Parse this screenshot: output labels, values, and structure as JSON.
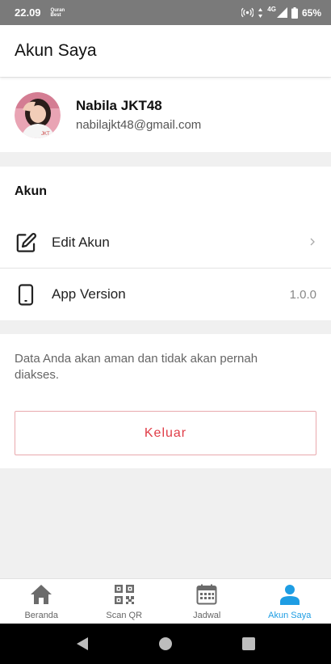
{
  "status_bar": {
    "time": "22.09",
    "app_badge_line1": "Quran",
    "app_badge_line2": "Best",
    "network": "4G",
    "battery": "65%"
  },
  "header": {
    "title": "Akun Saya"
  },
  "profile": {
    "name": "Nabila JKT48",
    "email": "nabilajkt48@gmail.com"
  },
  "account_section": {
    "title": "Akun",
    "items": [
      {
        "label": "Edit Akun",
        "icon": "edit-icon",
        "trailing_icon": "chevron-right-icon"
      },
      {
        "label": "App Version",
        "icon": "phone-icon",
        "value": "1.0.0"
      }
    ]
  },
  "info": {
    "text": "Data Anda akan aman dan tidak akan pernah diakses.",
    "logout_label": "Keluar"
  },
  "bottom_nav": {
    "items": [
      {
        "label": "Beranda",
        "icon": "home-icon",
        "active": false
      },
      {
        "label": "Scan QR",
        "icon": "qr-code-icon",
        "active": false
      },
      {
        "label": "Jadwal",
        "icon": "calendar-icon",
        "active": false
      },
      {
        "label": "Akun Saya",
        "icon": "person-icon",
        "active": true
      }
    ]
  },
  "colors": {
    "accent": "#1e9de3",
    "logout": "#e03c47",
    "status_bar": "#7a7a7a"
  }
}
